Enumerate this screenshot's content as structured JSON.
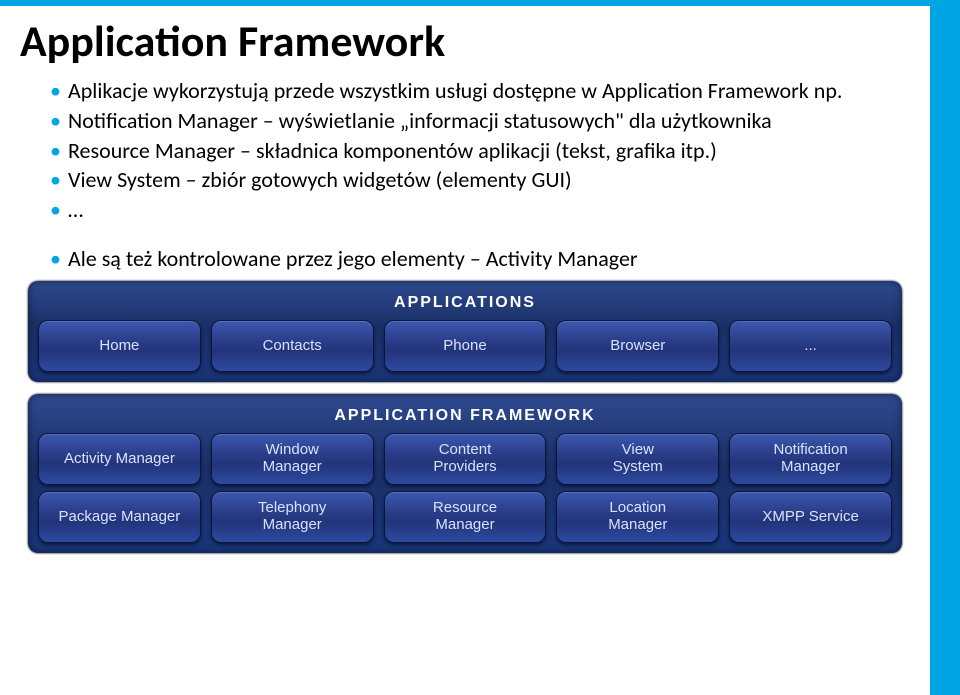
{
  "title": "Application Framework",
  "bullets_top": [
    "Aplikacje wykorzystują przede wszystkim usługi dostępne w Application Framework np.",
    "Notification Manager – wyświetlanie „informacji statusowych\" dla użytkownika",
    "Resource Manager – składnica komponentów aplikacji (tekst, grafika itp.)",
    "View System – zbiór gotowych widgetów (elementy GUI)",
    "…"
  ],
  "bullets_bottom": [
    "Ale są też kontrolowane przez jego elementy – Activity Manager"
  ],
  "diagram": {
    "layers": [
      {
        "title": "Applications",
        "rows": [
          [
            "Home",
            "Contacts",
            "Phone",
            "Browser",
            "..."
          ]
        ]
      },
      {
        "title": "Application Framework",
        "rows": [
          [
            "Activity Manager",
            "Window\nManager",
            "Content\nProviders",
            "View\nSystem",
            "Notification\nManager"
          ],
          [
            "Package Manager",
            "Telephony\nManager",
            "Resource\nManager",
            "Location\nManager",
            "XMPP Service"
          ]
        ]
      }
    ]
  }
}
